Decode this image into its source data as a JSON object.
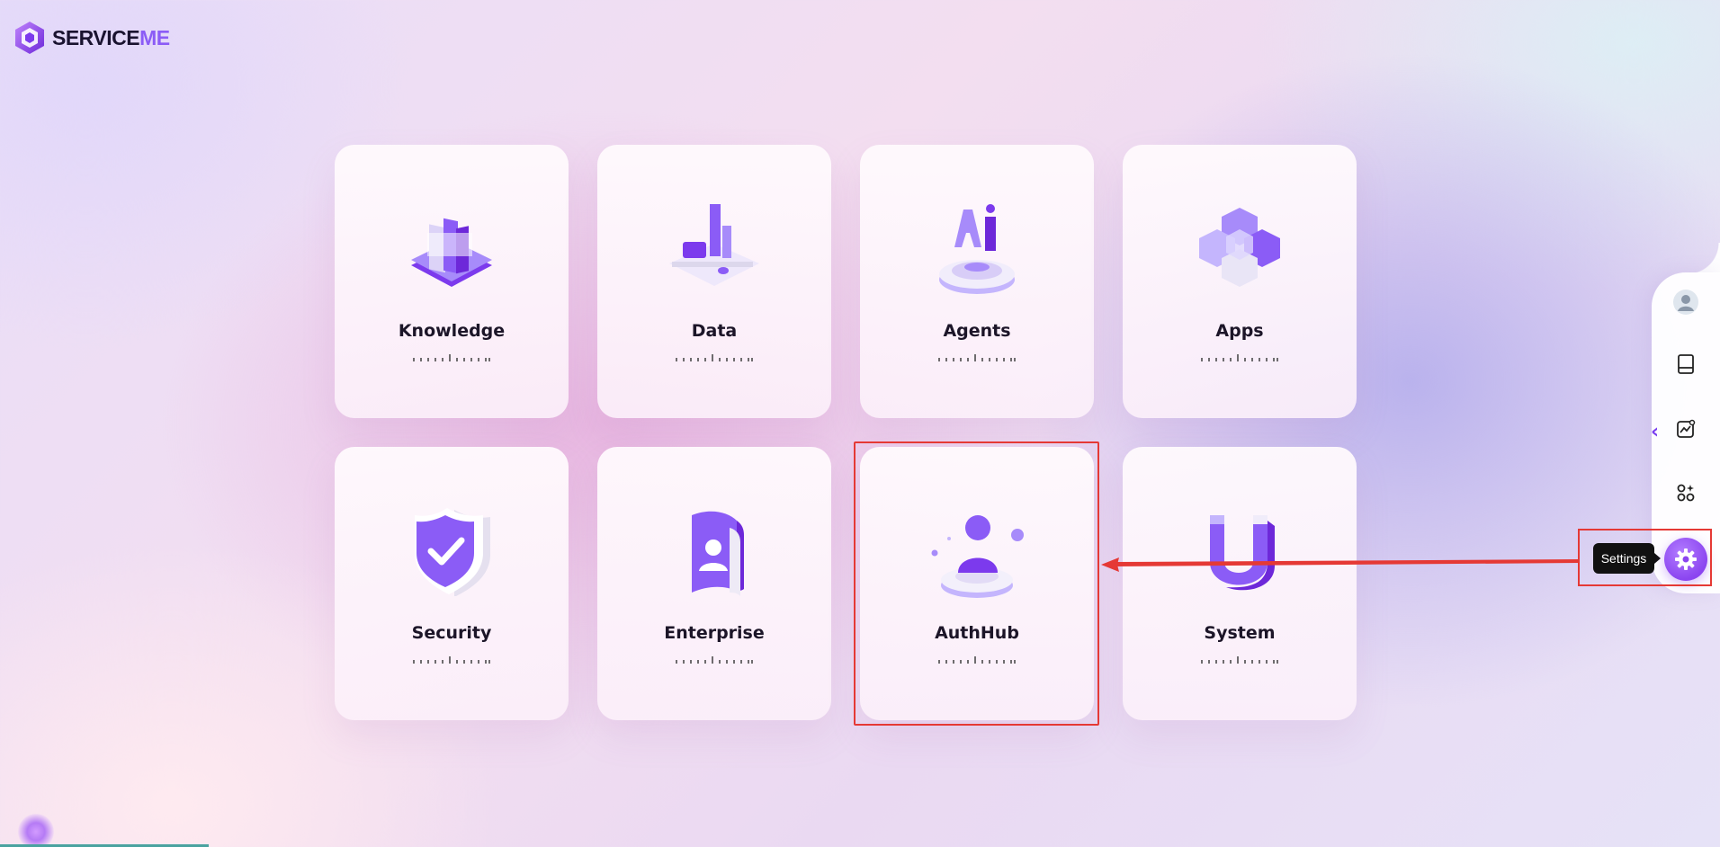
{
  "brand": {
    "name_primary": "SERVICE",
    "name_accent": "ME",
    "accent_color": "#8b5cf6"
  },
  "cards": [
    {
      "title": "Knowledge",
      "icon": "books-icon"
    },
    {
      "title": "Data",
      "icon": "bar-chart-icon"
    },
    {
      "title": "Agents",
      "icon": "ai-agent-icon"
    },
    {
      "title": "Apps",
      "icon": "cubes-icon"
    },
    {
      "title": "Security",
      "icon": "shield-check-icon"
    },
    {
      "title": "Enterprise",
      "icon": "enterprise-badge-icon"
    },
    {
      "title": "AuthHub",
      "icon": "user-auth-icon"
    },
    {
      "title": "System",
      "icon": "magnet-icon"
    }
  ],
  "sidebar": {
    "items": [
      "user-avatar",
      "book-icon",
      "chart-icon",
      "apps-icon"
    ],
    "collapse_glyph": "‹",
    "settings_tooltip": "Settings"
  },
  "annotation": {
    "highlight_color": "#e53935"
  }
}
